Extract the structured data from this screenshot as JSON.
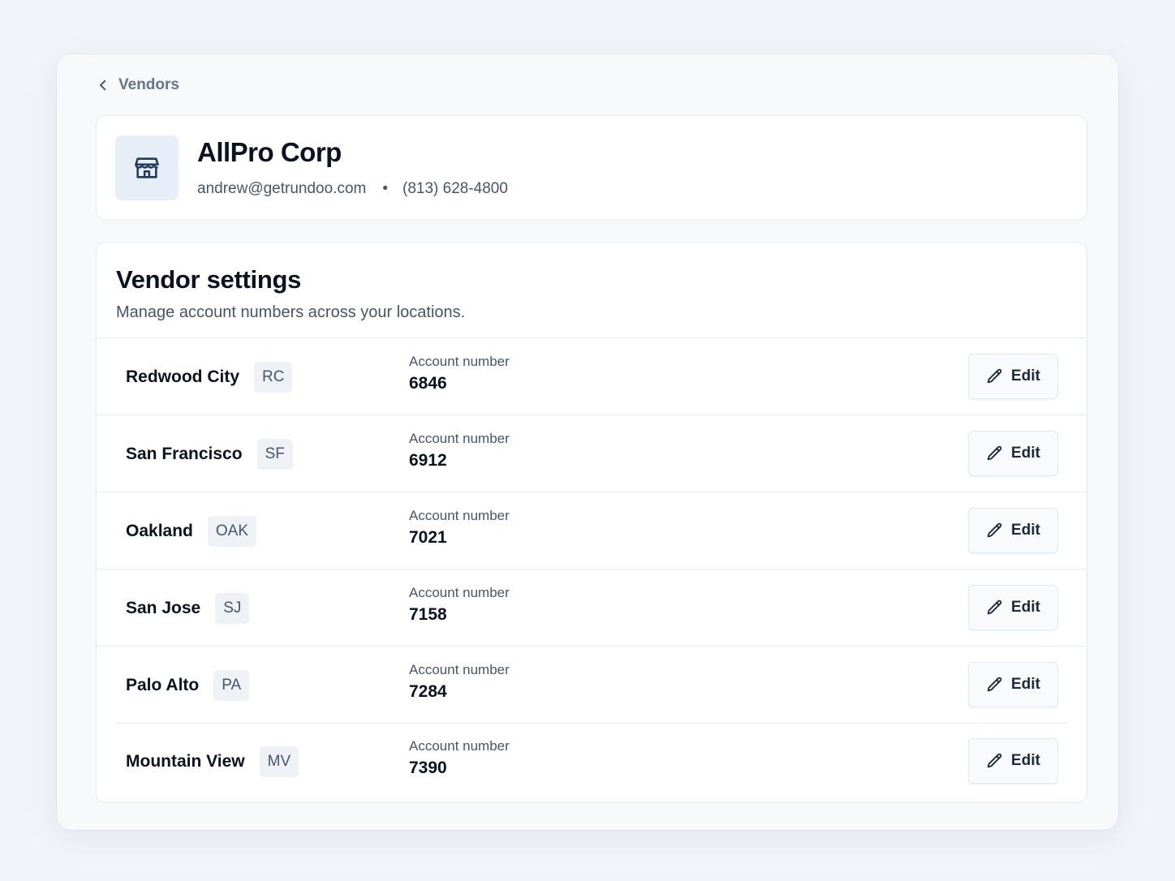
{
  "breadcrumb": {
    "label": "Vendors"
  },
  "vendor": {
    "name": "AllPro Corp",
    "email": "andrew@getrundoo.com",
    "separator": "•",
    "phone": "(813) 628-4800",
    "icon": "storefront-icon"
  },
  "settings": {
    "title": "Vendor settings",
    "subtitle": "Manage account numbers across your locations.",
    "account_label": "Account number",
    "edit_label": "Edit",
    "locations": [
      {
        "name": "Redwood City",
        "code": "RC",
        "account": "6846"
      },
      {
        "name": "San Francisco",
        "code": "SF",
        "account": "6912"
      },
      {
        "name": "Oakland",
        "code": "OAK",
        "account": "7021"
      },
      {
        "name": "San Jose",
        "code": "SJ",
        "account": "7158"
      },
      {
        "name": "Palo Alto",
        "code": "PA",
        "account": "7284"
      },
      {
        "name": "Mountain View",
        "code": "MV",
        "account": "7390"
      }
    ]
  },
  "colors": {
    "page_bg": "#f1f4f9",
    "card_bg": "#ffffff",
    "icon_tile_bg": "#e8eef7",
    "text_primary": "#0b1220",
    "text_muted": "#475569"
  }
}
